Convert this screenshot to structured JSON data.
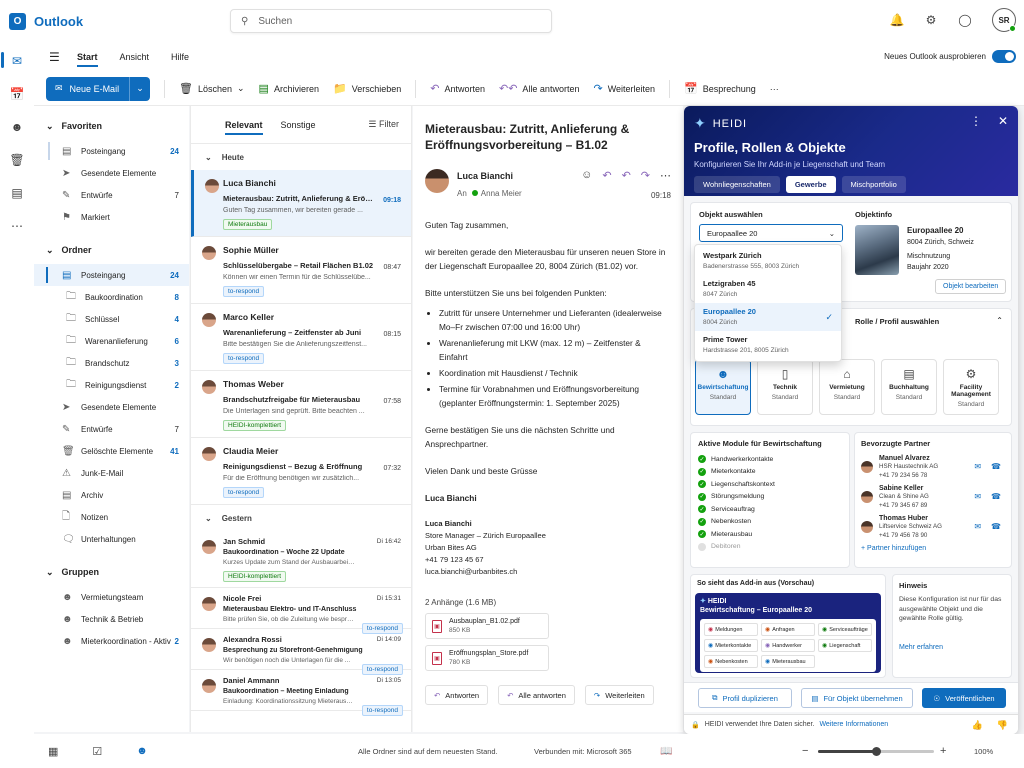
{
  "app": {
    "title": "Outlook",
    "logo_letter": "O"
  },
  "search": {
    "placeholder": "Suchen"
  },
  "user": {
    "initials": "SR"
  },
  "menu": {
    "tabs": [
      "Start",
      "Ansicht",
      "Hilfe"
    ],
    "try_new": "Neues Outlook ausprobieren"
  },
  "toolbar": {
    "new_mail": "Neue E-Mail",
    "delete": "Löschen",
    "archive": "Archivieren",
    "move": "Verschieben",
    "reply": "Antworten",
    "reply_all": "Alle antworten",
    "forward": "Weiterleiten",
    "meeting": "Besprechung",
    "more": "···"
  },
  "folders": {
    "favorites_title": "Favoriten",
    "favorites": [
      {
        "name": "Posteingang",
        "count": "24"
      },
      {
        "name": "Gesendete Elemente",
        "count": ""
      },
      {
        "name": "Entwürfe",
        "count": "7"
      },
      {
        "name": "Markiert",
        "count": ""
      }
    ],
    "folders_title": "Ordner",
    "inbox": {
      "name": "Posteingang",
      "count": "24"
    },
    "subfolders": [
      {
        "name": "Baukoordination",
        "count": "8"
      },
      {
        "name": "Schlüssel",
        "count": "4"
      },
      {
        "name": "Warenanlieferung",
        "count": "6"
      },
      {
        "name": "Brandschutz",
        "count": "3"
      },
      {
        "name": "Reinigungsdienst",
        "count": "2"
      }
    ],
    "others": [
      {
        "name": "Gesendete Elemente",
        "count": ""
      },
      {
        "name": "Entwürfe",
        "count": "7"
      },
      {
        "name": "Gelöschte Elemente",
        "count": "41"
      },
      {
        "name": "Junk-E-Mail",
        "count": ""
      },
      {
        "name": "Archiv",
        "count": ""
      },
      {
        "name": "Notizen",
        "count": ""
      },
      {
        "name": "Unterhaltungen",
        "count": ""
      }
    ],
    "groups_title": "Gruppen",
    "groups": [
      {
        "name": "Vermietungsteam",
        "count": ""
      },
      {
        "name": "Technik & Betrieb",
        "count": ""
      },
      {
        "name": "Mieterkoordination - Aktiv",
        "count": "2"
      }
    ]
  },
  "maillist": {
    "tabs": [
      "Relevant",
      "Sonstige"
    ],
    "filter": "Filter",
    "group_today": "Heute",
    "group_yesterday": "Gestern",
    "today": [
      {
        "sender": "Luca Bianchi",
        "subject": "Mieterausbau: Zutritt, Anlieferung & Eröffnu...",
        "preview": "Guten Tag zusammen, wir bereiten gerade ...",
        "time": "09:18",
        "tag": "Mieterausbau",
        "tag_color": "green"
      },
      {
        "sender": "Sophie Müller",
        "subject": "Schlüsselübergabe – Retail Flächen B1.02",
        "preview": "Können wir einen Termin für die Schlüsselübe...",
        "time": "08:47",
        "tag": "to-respond",
        "tag_color": "blue"
      },
      {
        "sender": "Marco Keller",
        "subject": "Warenanlieferung – Zeitfenster ab Juni",
        "preview": "Bitte bestätigen Sie die Anlieferungszeitfenst...",
        "time": "08:15",
        "tag": "to-respond",
        "tag_color": "blue"
      },
      {
        "sender": "Thomas Weber",
        "subject": "Brandschutzfreigabe für Mieterausbau",
        "preview": "Die Unterlagen sind geprüft. Bitte beachten ...",
        "time": "07:58",
        "tag": "HEIDI-komplettiert",
        "tag_color": "green"
      },
      {
        "sender": "Claudia Meier",
        "subject": "Reinigungsdienst – Bezug & Eröffnung",
        "preview": "Für die Eröffnung benötigen wir zusätzlich...",
        "time": "07:32",
        "tag": "to-respond",
        "tag_color": "blue"
      }
    ],
    "yesterday": [
      {
        "sender": "Jan Schmid",
        "subject": "Baukoordination – Woche 22 Update",
        "preview": "Kurzes Update zum Stand der Ausbauarbeiten...",
        "time": "Di 16:42",
        "tag": "HEIDI-komplettiert",
        "tag_color": "green",
        "tag_right": false
      },
      {
        "sender": "Nicole Frei",
        "subject": "Mieterausbau Elektro- und IT-Anschluss",
        "preview": "Bitte prüfen Sie, ob die Zuleitung wie besproc...",
        "time": "Di 15:31",
        "tag": "to-respond",
        "tag_color": "blue",
        "tag_right": true
      },
      {
        "sender": "Alexandra Rossi",
        "subject": "Besprechung zu Storefront-Genehmigung",
        "preview": "Wir benötigen noch die Unterlagen für die ...",
        "time": "Di 14:09",
        "tag": "to-respond",
        "tag_color": "blue",
        "tag_right": true
      },
      {
        "sender": "Daniel Ammann",
        "subject": "Baukoordination – Meeting Einladung",
        "preview": "Einladung: Koordinationssitzung Mieterausba...",
        "time": "Di 13:05",
        "tag": "to-respond",
        "tag_color": "blue",
        "tag_right": true
      }
    ]
  },
  "reading": {
    "title": "Mieterausbau: Zutritt, Anlieferung & Eröffnungsvorbereitung – B1.02",
    "sender": "Luca Bianchi",
    "to_label": "An",
    "to": "Anna Meier",
    "time": "09:18",
    "greeting": "Guten Tag zusammen,",
    "p1": "wir bereiten gerade den Mieterausbau für unseren neuen Store in der Liegenschaft Europaallee 20, 8004 Zürich (B1.02) vor.",
    "p2": "Bitte unterstützen Sie uns bei folgenden Punkten:",
    "bullets": [
      "Zutritt für unsere Unternehmer und Lieferanten (idealerweise Mo–Fr zwischen 07:00 und 16:00 Uhr)",
      "Warenanlieferung mit LKW (max. 12 m) – Zeitfenster & Einfahrt",
      "Koordination mit Hausdienst / Technik",
      "Termine für Vorabnahmen und Eröffnungsvorbereitung (geplanter Eröffnungstermin: 1. September 2025)"
    ],
    "p3": "Gerne bestätigen Sie uns die nächsten Schritte und Ansprechpartner.",
    "closing": "Vielen Dank und beste Grüsse",
    "signoff": "Luca Bianchi",
    "sig": [
      "Luca Bianchi",
      "Store Manager – Zürich Europaallee",
      "Urban Bites AG",
      "+41 79 123 45 67",
      "luca.bianchi@urbanbites.ch"
    ],
    "attachments_header": "2 Anhänge (1.6 MB)",
    "attachments": [
      {
        "name": "Ausbauplan_B1.02.pdf",
        "size": "850 KB"
      },
      {
        "name": "Eröffnungsplan_Store.pdf",
        "size": "780 KB"
      }
    ],
    "btn_reply": "Antworten",
    "btn_reply_all": "Alle antworten",
    "btn_forward": "Weiterleiten"
  },
  "heidi": {
    "brand": "HEIDI",
    "title": "Profile, Rollen & Objekte",
    "subtitle": "Konfigurieren Sie Ihr Add-in je Liegenschaft und Team",
    "tabs": [
      "Wohnliegenschaften",
      "Gewerbe",
      "Mischportfolio"
    ],
    "object_label": "Objekt auswählen",
    "object_selected": "Europaallee 20",
    "dropdown": [
      {
        "name": "Westpark Zürich",
        "addr": "Badenerstrasse 555, 8003 Zürich"
      },
      {
        "name": "Letzigraben 45",
        "addr": "8047 Zürich"
      },
      {
        "name": "Europaallee 20",
        "addr": "8004 Zürich"
      },
      {
        "name": "Prime Tower",
        "addr": "Hardstrasse 201, 8005 Zürich"
      }
    ],
    "objinfo_label": "Objektinfo",
    "objinfo": {
      "name": "Europaallee 20",
      "city": "8004 Zürich, Schweiz",
      "type": "Mischnutzung",
      "year": "Baujahr 2020",
      "edit": "Objekt bearbeiten"
    },
    "role_label": "Rolle / Profil auswählen",
    "roles": [
      {
        "name": "Bewirtschaftung",
        "level": "Standard"
      },
      {
        "name": "Technik",
        "level": "Standard"
      },
      {
        "name": "Vermietung",
        "level": "Standard"
      },
      {
        "name": "Buchhaltung",
        "level": "Standard"
      },
      {
        "name": "Facility Management",
        "level": "Standard"
      }
    ],
    "modules_title": "Aktive Module für Bewirtschaftung",
    "modules": [
      {
        "name": "Handwerkerkontakte",
        "on": true
      },
      {
        "name": "Mieterkontakte",
        "on": true
      },
      {
        "name": "Liegenschaftskontext",
        "on": true
      },
      {
        "name": "Störungsmeldung",
        "on": true
      },
      {
        "name": "Serviceauftrag",
        "on": true
      },
      {
        "name": "Nebenkosten",
        "on": true
      },
      {
        "name": "Mieterausbau",
        "on": true
      },
      {
        "name": "Debitoren",
        "on": false
      }
    ],
    "partners_title": "Bevorzugte Partner",
    "partners": [
      {
        "name": "Manuel Alvarez",
        "company": "HSR Haustechnik AG",
        "phone": "+41 79 234 56 78"
      },
      {
        "name": "Sabine Keller",
        "company": "Clean & Shine AG",
        "phone": "+41 79 345 67 89"
      },
      {
        "name": "Thomas Huber",
        "company": "Liftservice Schweiz AG",
        "phone": "+41 79 456 78 90"
      }
    ],
    "add_partner": "+ Partner hinzufügen",
    "preview_title": "So sieht das Add-in aus (Vorschau)",
    "preview_brand": "HEIDI",
    "preview_sub": "Bewirtschaftung – Europaallee 20",
    "preview_mods": [
      "Meldungen",
      "Anfragen",
      "Serviceaufträge",
      "Mieterkontakte",
      "Handwerker",
      "Liegenschaft",
      "Nebenkosten",
      "Mieterausbau"
    ],
    "hint_title": "Hinweis",
    "hint_text": "Diese Konfiguration ist nur für das ausgewählte Objekt und die gewählte Rolle gültig.",
    "hint_link": "Mehr erfahren",
    "btn_duplicate": "Profil duplizieren",
    "btn_apply": "Für Objekt übernehmen",
    "btn_publish": "Veröffentlichen",
    "footer_text": "HEIDI verwendet Ihre Daten sicher.",
    "footer_link": "Weitere Informationen"
  },
  "status": {
    "synced": "Alle Ordner sind auf dem neuesten Stand.",
    "connected": "Verbunden mit: Microsoft 365",
    "zoom": "100%",
    "zoom_level": 0.5
  }
}
